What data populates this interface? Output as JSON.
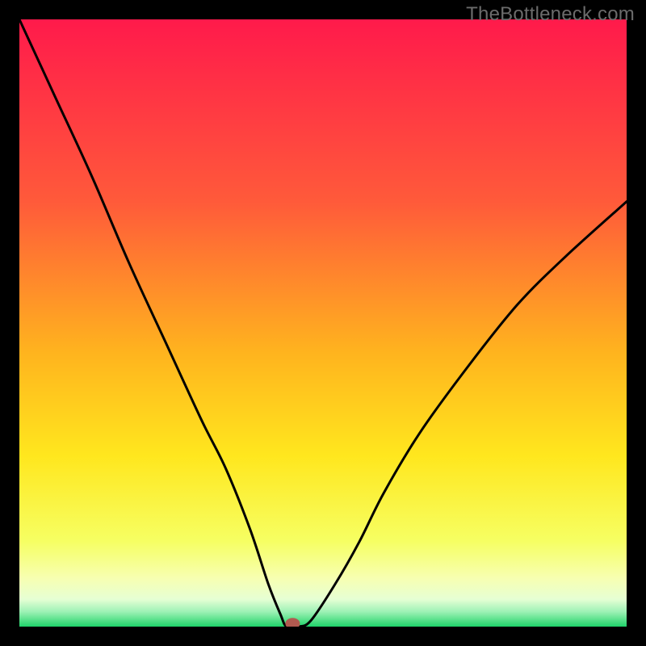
{
  "watermark": "TheBottleneck.com",
  "chart_data": {
    "type": "line",
    "title": "",
    "xlabel": "",
    "ylabel": "",
    "xlim": [
      0,
      100
    ],
    "ylim": [
      0,
      100
    ],
    "x": [
      0,
      6,
      12,
      18,
      24,
      30,
      34,
      38,
      41,
      43,
      44,
      46,
      48,
      52,
      56,
      60,
      66,
      74,
      82,
      90,
      100
    ],
    "y": [
      100,
      87,
      74,
      60,
      47,
      34,
      26,
      16,
      7,
      2,
      0,
      0,
      1,
      7,
      14,
      22,
      32,
      43,
      53,
      61,
      70
    ],
    "annotations": [
      {
        "type": "marker",
        "x": 45,
        "y": 0.5,
        "color": "#b15a50"
      }
    ],
    "gradient_stops": [
      {
        "offset": 0.0,
        "color": "#ff1a4b"
      },
      {
        "offset": 0.3,
        "color": "#ff5a3a"
      },
      {
        "offset": 0.55,
        "color": "#ffb41e"
      },
      {
        "offset": 0.72,
        "color": "#ffe71e"
      },
      {
        "offset": 0.86,
        "color": "#f6ff63"
      },
      {
        "offset": 0.92,
        "color": "#f7ffb1"
      },
      {
        "offset": 0.955,
        "color": "#e6ffd4"
      },
      {
        "offset": 0.975,
        "color": "#9ff2b6"
      },
      {
        "offset": 1.0,
        "color": "#1fd36a"
      }
    ]
  }
}
